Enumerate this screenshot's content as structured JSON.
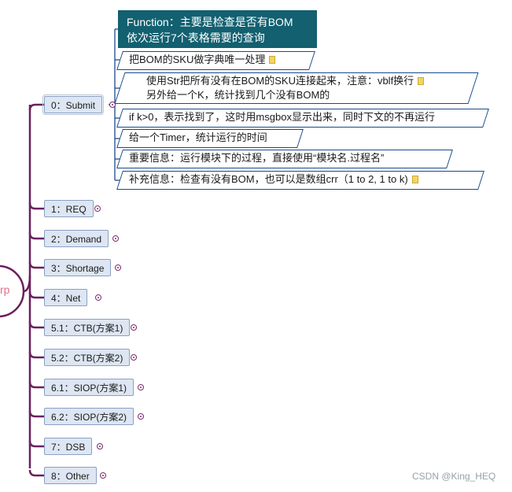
{
  "root": {
    "label": "rp"
  },
  "main_topic": {
    "label": "0：Submit",
    "note_title": "Function：主要是检查是否有BOM\n依次运行7个表格需要的查询",
    "details": [
      {
        "text": "把BOM的SKU做字典唯一处理",
        "has_note_icon": true
      },
      {
        "text_lines": [
          "使用Str把所有没有在BOM的SKU连接起来，注意：vblf换行",
          "另外给一个K，统计找到几个没有BOM的"
        ],
        "has_note_icon": true
      },
      {
        "text": "if k>0，表示找到了，这时用msgbox显示出来，同时下文的不再运行",
        "has_note_icon": false
      },
      {
        "text": "给一个Timer，统计运行的时间",
        "has_note_icon": false
      },
      {
        "text": "重要信息：运行模块下的过程，直接使用“模块名.过程名”",
        "has_note_icon": false
      },
      {
        "text": "补充信息：检查有没有BOM，也可以是数组crr（1 to 2, 1 to k)",
        "has_note_icon": true
      }
    ]
  },
  "topics": [
    {
      "label": "1：REQ"
    },
    {
      "label": "2：Demand"
    },
    {
      "label": "3：Shortage"
    },
    {
      "label": "4：Net"
    },
    {
      "label": "5.1：CTB(方案1)"
    },
    {
      "label": "5.2：CTB(方案2)"
    },
    {
      "label": "6.1：SIOP(方案1)"
    },
    {
      "label": "6.2：SIOP(方案2)"
    },
    {
      "label": "7：DSB"
    },
    {
      "label": "8：Other"
    }
  ],
  "watermark": "CSDN @King_HEQ",
  "colors": {
    "branch_line": "#6b1f5e",
    "detail_line": "#1a4a8a",
    "topic_fill": "#dde6f2",
    "topic_border": "#8aa0c4",
    "note_box_fill": "#126070"
  }
}
